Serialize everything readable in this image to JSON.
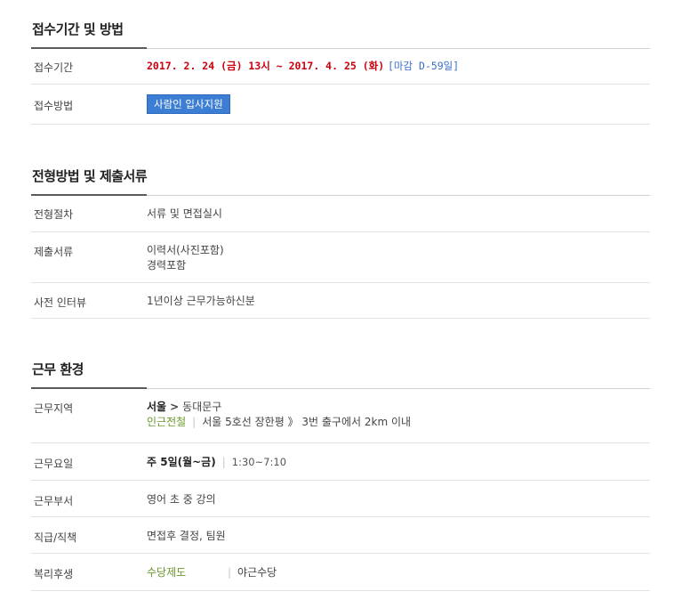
{
  "section1": {
    "title": "접수기간 및 방법",
    "rows": {
      "period": {
        "label": "접수기간",
        "range": "2017. 2. 24 (금) 13시 ~ 2017. 4. 25 (화)",
        "deadline": "[마감 D-59일]"
      },
      "method": {
        "label": "접수방법",
        "button": "사람인 입사지원"
      }
    }
  },
  "section2": {
    "title": "전형방법 및 제출서류",
    "rows": {
      "process": {
        "label": "전형절차",
        "value": "서류 및 면접실시"
      },
      "documents": {
        "label": "제출서류",
        "line1": "이력서(사진포함)",
        "line2": "경력포함"
      },
      "interview": {
        "label": "사전 인터뷰",
        "value": "1년이상 근무가능하신분"
      }
    }
  },
  "section3": {
    "title": "근무 환경",
    "rows": {
      "location": {
        "label": "근무지역",
        "city": "서울",
        "arrow": ">",
        "district": "동대문구",
        "station_link": "인근전철",
        "station_info": "서울 5호선 장한평 》 3번 출구에서 2km 이내"
      },
      "days": {
        "label": "근무요일",
        "days": "주 5일(월~금)",
        "hours": "1:30~7:10"
      },
      "dept": {
        "label": "근무부서",
        "value": "영어 초 중 강의"
      },
      "position": {
        "label": "직급/직책",
        "value": "면접후 결정, 팀원"
      },
      "welfare": {
        "label": "복리후생",
        "item1": "수당제도",
        "item2": "야근수당"
      }
    }
  },
  "colors": {
    "accent_red": "#c8000d",
    "accent_blue": "#3a6ec8",
    "button_blue": "#3d7ed5",
    "green": "#6a9a2a"
  }
}
